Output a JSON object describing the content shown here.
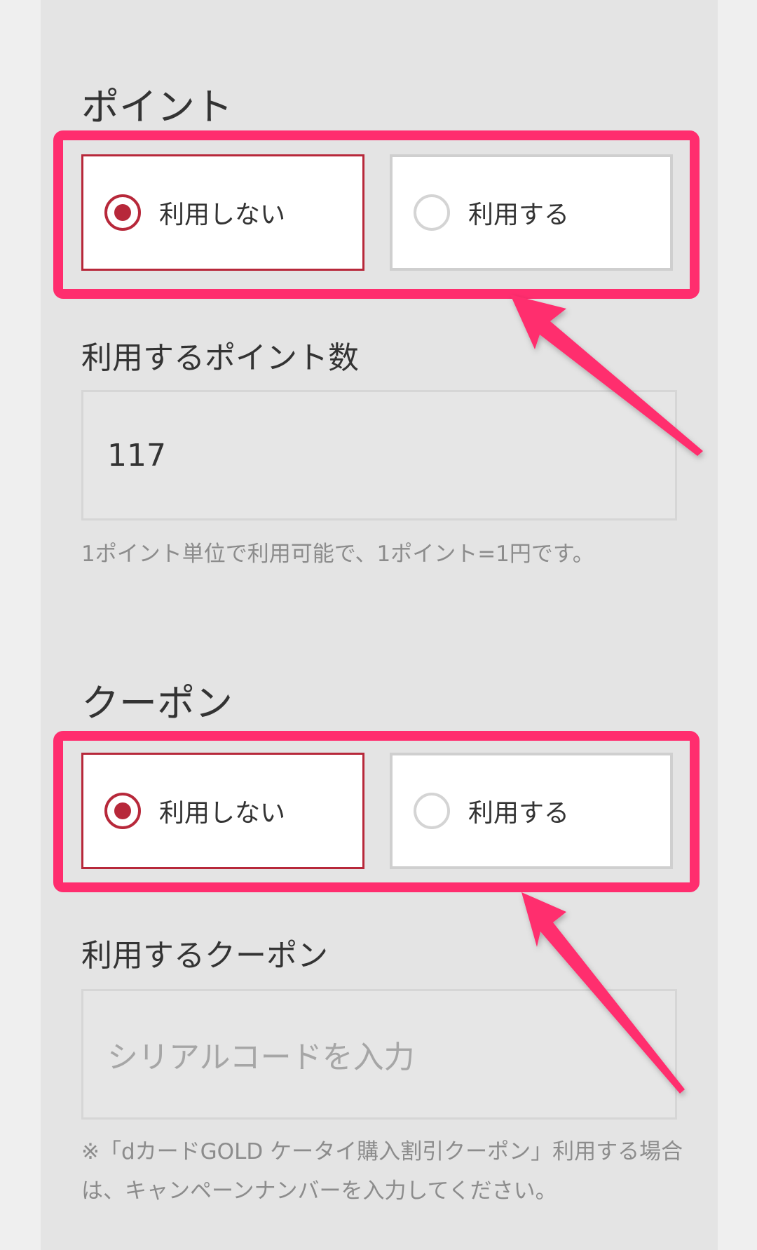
{
  "points": {
    "heading": "ポイント",
    "options": [
      {
        "label": "利用しない",
        "selected": true
      },
      {
        "label": "利用する",
        "selected": false
      }
    ],
    "amount_label": "利用するポイント数",
    "amount_value": "117",
    "help": "1ポイント単位で利用可能で、1ポイント=1円です。"
  },
  "coupon": {
    "heading": "クーポン",
    "options": [
      {
        "label": "利用しない",
        "selected": true
      },
      {
        "label": "利用する",
        "selected": false
      }
    ],
    "code_label": "利用するクーポン",
    "code_placeholder": "シリアルコードを入力",
    "help": "※「dカードGOLD ケータイ購入割引クーポン」利用する場合は、キャンペーンナンバーを入力してください。"
  },
  "colors": {
    "selected": "#b7283a",
    "annotation": "#ff2d6e",
    "panel": "#e4e4e4"
  }
}
